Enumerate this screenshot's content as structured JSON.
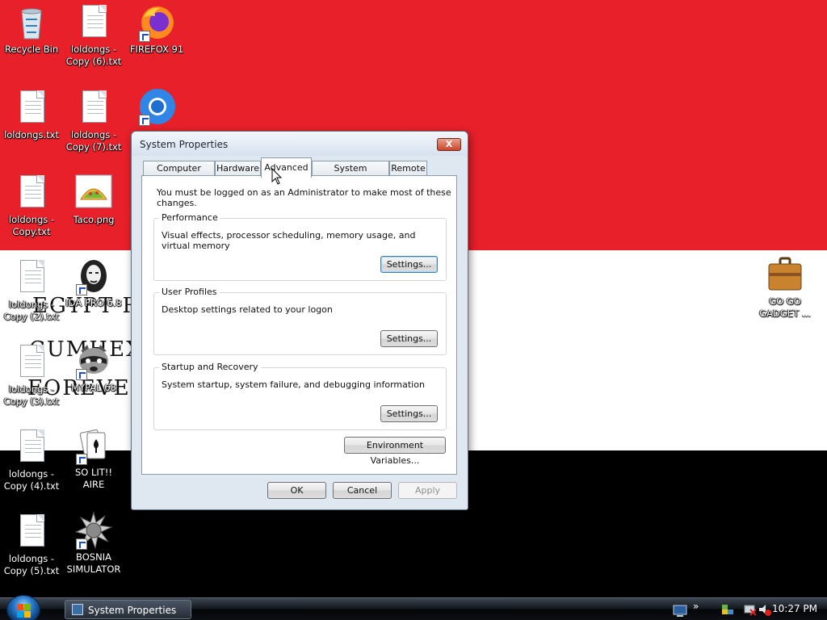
{
  "desktop": {
    "icons": [
      {
        "label": "Recycle Bin"
      },
      {
        "label": "loldongs - Copy (6).txt"
      },
      {
        "label": "FIREFOX 91"
      },
      {
        "label": "loldongs.txt"
      },
      {
        "label": "loldongs - Copy (7).txt"
      },
      {
        "label": "loldongs - Copy.txt"
      },
      {
        "label": "Taco.png"
      },
      {
        "label": "loldongs - Copy (2).txt"
      },
      {
        "label": "IDA PRO 6.8"
      },
      {
        "label": "loldongs - Copy (3).txt"
      },
      {
        "label": "MYPAL 68"
      },
      {
        "label": "loldongs - Copy (4).txt"
      },
      {
        "label": "SO LIT!! AIRE"
      },
      {
        "label": "loldongs - Copy (5).txt"
      },
      {
        "label": "BOSNIA SIMULATOR"
      },
      {
        "label": "GO GO GADGET ..."
      }
    ],
    "wallpaper_colors": {
      "top": "#e8202a",
      "middle": "#ffffff",
      "bottom": "#000000"
    }
  },
  "dialog": {
    "title": "System Properties",
    "close_glyph": "X",
    "tabs": [
      "Computer Name",
      "Hardware",
      "Advanced",
      "System Protection",
      "Remote"
    ],
    "active_tab": "Advanced",
    "intro": "You must be logged on as an Administrator to make most of these changes.",
    "groups": [
      {
        "title": "Performance",
        "desc": "Visual effects, processor scheduling, memory usage, and virtual memory",
        "button": "Settings..."
      },
      {
        "title": "User Profiles",
        "desc": "Desktop settings related to your logon",
        "button": "Settings..."
      },
      {
        "title": "Startup and Recovery",
        "desc": "System startup, system failure, and debugging information",
        "button": "Settings..."
      }
    ],
    "env_button": "Environment Variables...",
    "ok": "OK",
    "cancel": "Cancel",
    "apply": "Apply"
  },
  "taskbar": {
    "task": "System Properties",
    "clock": "10:27 PM",
    "overflow": "»"
  }
}
